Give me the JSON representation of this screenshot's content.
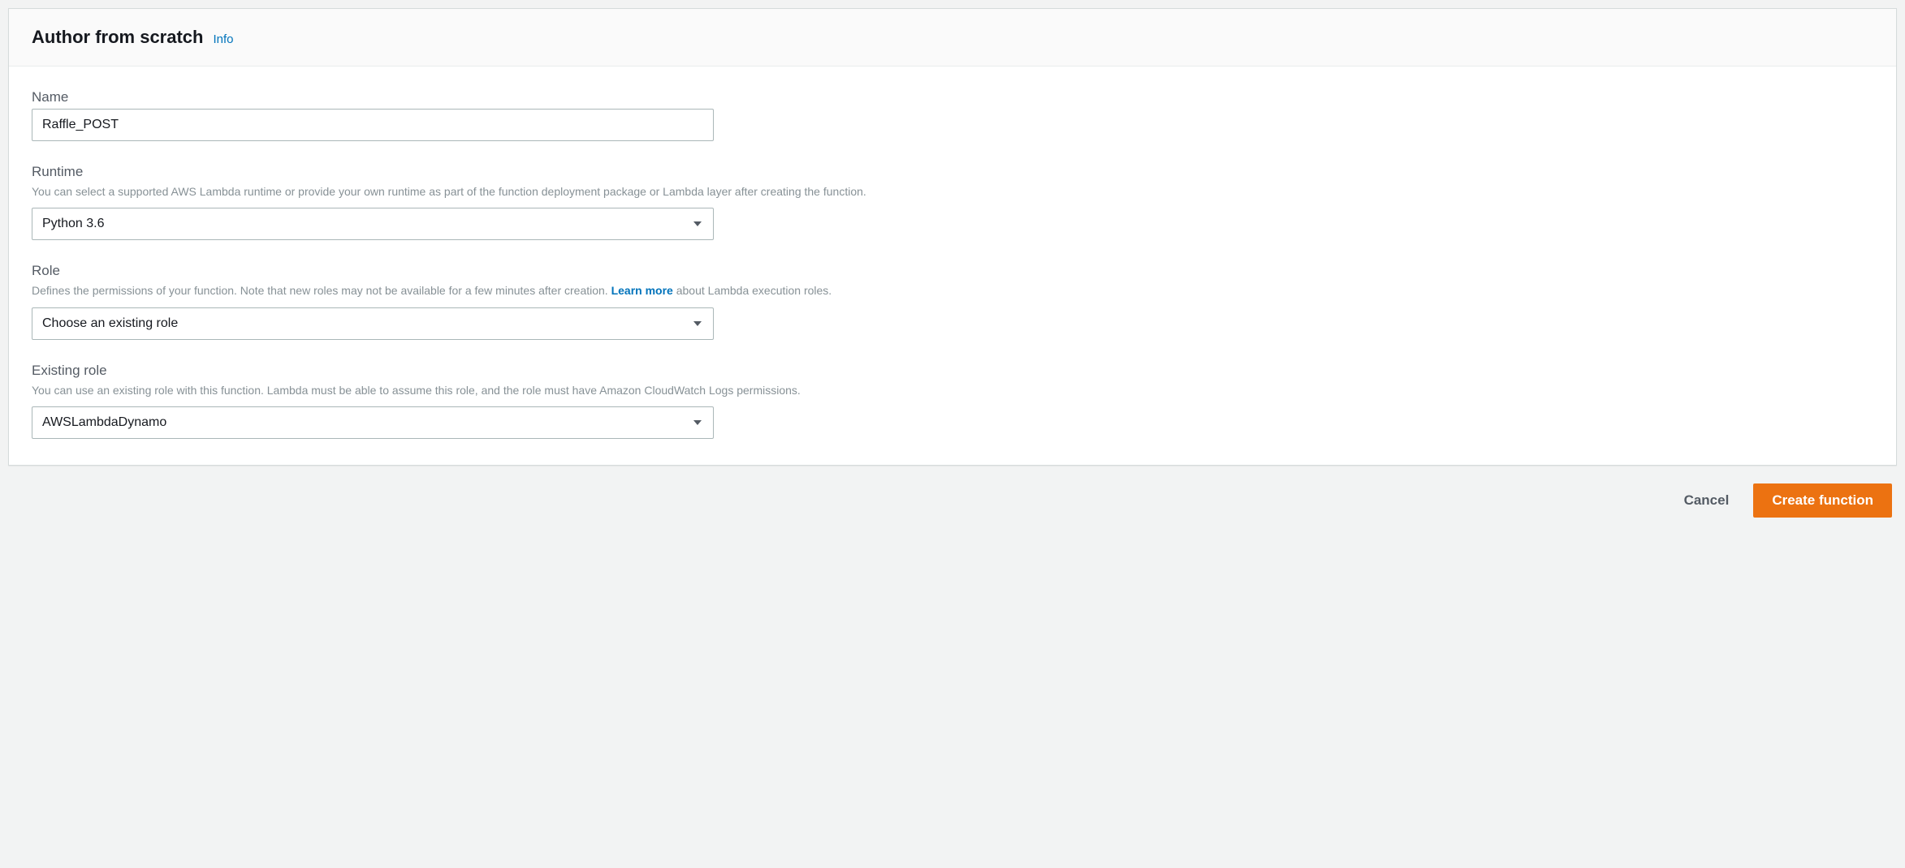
{
  "header": {
    "title": "Author from scratch",
    "info_label": "Info"
  },
  "fields": {
    "name": {
      "label": "Name",
      "value": "Raffle_POST"
    },
    "runtime": {
      "label": "Runtime",
      "hint": "You can select a supported AWS Lambda runtime or provide your own runtime as part of the function deployment package or Lambda layer after creating the function.",
      "value": "Python 3.6"
    },
    "role": {
      "label": "Role",
      "hint_before": "Defines the permissions of your function. Note that new roles may not be available for a few minutes after creation. ",
      "learn_more": "Learn more",
      "hint_after": " about Lambda execution roles.",
      "value": "Choose an existing role"
    },
    "existing_role": {
      "label": "Existing role",
      "hint": "You can use an existing role with this function. Lambda must be able to assume this role, and the role must have Amazon CloudWatch Logs permissions.",
      "value": "AWSLambdaDynamo"
    }
  },
  "actions": {
    "cancel": "Cancel",
    "create": "Create function"
  }
}
